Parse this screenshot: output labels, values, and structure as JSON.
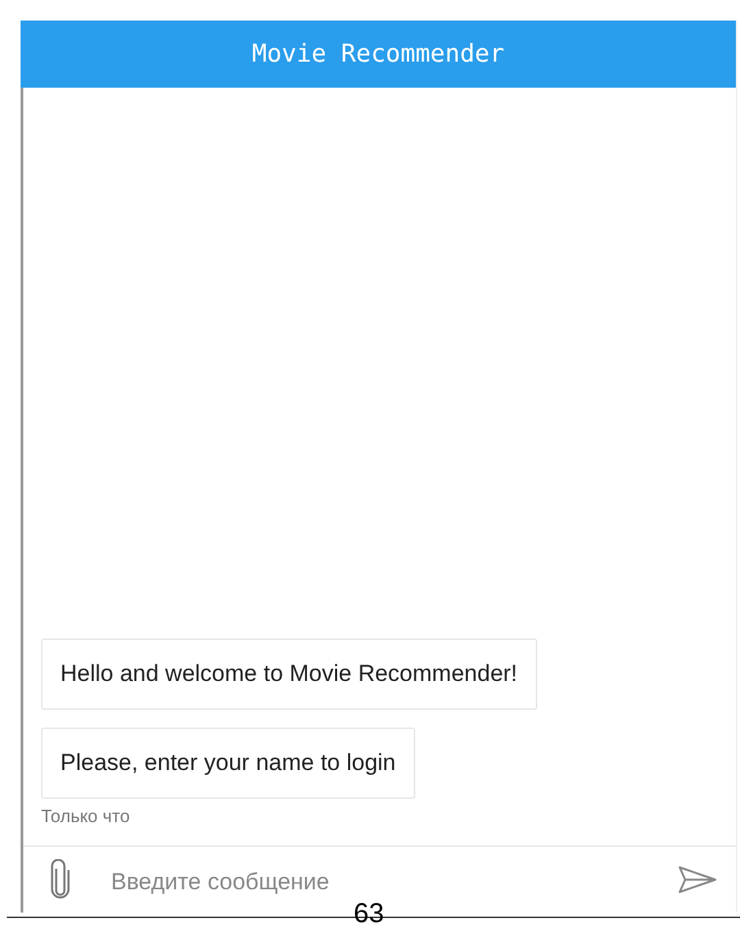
{
  "window": {
    "title": "Movie Recommender"
  },
  "messages": [
    {
      "text": "Hello and welcome to Movie Recommender!"
    },
    {
      "text": "Please, enter your name to login"
    }
  ],
  "timestamp": "Только что",
  "composer": {
    "placeholder": "Введите сообщение"
  },
  "page_number": "63"
}
